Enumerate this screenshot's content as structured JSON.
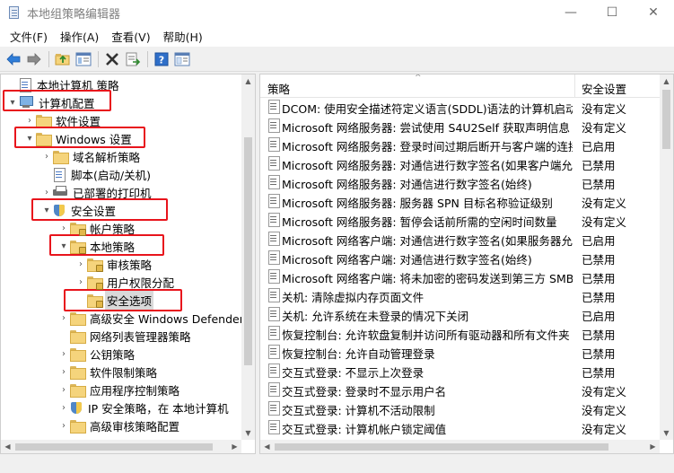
{
  "window": {
    "title": "本地组策略编辑器",
    "controls": {
      "minimize": "—",
      "maximize": "☐",
      "close": "✕"
    }
  },
  "menu": [
    "文件(F)",
    "操作(A)",
    "查看(V)",
    "帮助(H)"
  ],
  "toolbar": {
    "buttons": [
      "back-arrow-icon",
      "forward-arrow-icon",
      "up-folder-icon",
      "show-hide-tree-icon",
      "delete-icon",
      "export-list-icon",
      "help-icon",
      "properties-icon"
    ]
  },
  "tree": {
    "items": [
      {
        "label": "本地计算机 策略",
        "icon": "doc-icon",
        "indent": 0,
        "expander": ""
      },
      {
        "label": "计算机配置",
        "icon": "pc-icon",
        "indent": 0,
        "expander": "▾"
      },
      {
        "label": "软件设置",
        "icon": "folder-icon",
        "indent": 1,
        "expander": "›"
      },
      {
        "label": "Windows 设置",
        "icon": "folder-icon",
        "indent": 1,
        "expander": "▾"
      },
      {
        "label": "域名解析策略",
        "icon": "folder-icon",
        "indent": 2,
        "expander": "›"
      },
      {
        "label": "脚本(启动/关机)",
        "icon": "doc-icon",
        "indent": 2,
        "expander": ""
      },
      {
        "label": "已部署的打印机",
        "icon": "printer-icon",
        "indent": 2,
        "expander": "›"
      },
      {
        "label": "安全设置",
        "icon": "shield-icon",
        "indent": 2,
        "expander": "▾"
      },
      {
        "label": "帐户策略",
        "icon": "lock-folder-icon",
        "indent": 3,
        "expander": "›"
      },
      {
        "label": "本地策略",
        "icon": "lock-folder-icon",
        "indent": 3,
        "expander": "▾"
      },
      {
        "label": "审核策略",
        "icon": "lock-folder-icon",
        "indent": 4,
        "expander": "›"
      },
      {
        "label": "用户权限分配",
        "icon": "lock-folder-icon",
        "indent": 4,
        "expander": "›"
      },
      {
        "label": "安全选项",
        "icon": "lock-folder-icon",
        "indent": 4,
        "expander": "",
        "selected": true
      },
      {
        "label": "高级安全 Windows Defender",
        "icon": "folder-icon",
        "indent": 3,
        "expander": "›"
      },
      {
        "label": "网络列表管理器策略",
        "icon": "folder-icon",
        "indent": 3,
        "expander": ""
      },
      {
        "label": "公钥策略",
        "icon": "folder-icon",
        "indent": 3,
        "expander": "›"
      },
      {
        "label": "软件限制策略",
        "icon": "folder-icon",
        "indent": 3,
        "expander": "›"
      },
      {
        "label": "应用程序控制策略",
        "icon": "folder-icon",
        "indent": 3,
        "expander": "›"
      },
      {
        "label": "IP 安全策略，在 本地计算机",
        "icon": "shield-icon",
        "indent": 3,
        "expander": "›"
      },
      {
        "label": "高级审核策略配置",
        "icon": "folder-icon",
        "indent": 3,
        "expander": "›"
      }
    ]
  },
  "list": {
    "col_policy": "策略",
    "col_setting": "安全设置",
    "sort_indicator": "^",
    "rows": [
      {
        "policy": "DCOM: 使用安全描述符定义语言(SDDL)语法的计算机启动...",
        "setting": "没有定义"
      },
      {
        "policy": "Microsoft 网络服务器: 尝试使用 S4U2Self 获取声明信息",
        "setting": "没有定义"
      },
      {
        "policy": "Microsoft 网络服务器: 登录时间过期后断开与客户端的连接",
        "setting": "已启用"
      },
      {
        "policy": "Microsoft 网络服务器: 对通信进行数字签名(如果客户端允...",
        "setting": "已禁用"
      },
      {
        "policy": "Microsoft 网络服务器: 对通信进行数字签名(始终)",
        "setting": "已禁用"
      },
      {
        "policy": "Microsoft 网络服务器: 服务器 SPN 目标名称验证级别",
        "setting": "没有定义"
      },
      {
        "policy": "Microsoft 网络服务器: 暂停会话前所需的空闲时间数量",
        "setting": "没有定义"
      },
      {
        "policy": "Microsoft 网络客户端: 对通信进行数字签名(如果服务器允...",
        "setting": "已启用"
      },
      {
        "policy": "Microsoft 网络客户端: 对通信进行数字签名(始终)",
        "setting": "已禁用"
      },
      {
        "policy": "Microsoft 网络客户端: 将未加密的密码发送到第三方 SMB...",
        "setting": "已禁用"
      },
      {
        "policy": "关机: 清除虚拟内存页面文件",
        "setting": "已禁用"
      },
      {
        "policy": "关机: 允许系统在未登录的情况下关闭",
        "setting": "已启用"
      },
      {
        "policy": "恢复控制台: 允许软盘复制并访问所有驱动器和所有文件夹",
        "setting": "已禁用"
      },
      {
        "policy": "恢复控制台: 允许自动管理登录",
        "setting": "已禁用"
      },
      {
        "policy": "交互式登录: 不显示上次登录",
        "setting": "已禁用"
      },
      {
        "policy": "交互式登录: 登录时不显示用户名",
        "setting": "没有定义"
      },
      {
        "policy": "交互式登录: 计算机不活动限制",
        "setting": "没有定义"
      },
      {
        "policy": "交互式登录: 计算机帐户锁定阈值",
        "setting": "没有定义"
      }
    ]
  },
  "scrollbars": {
    "left_vertical_position": 0.45,
    "right_vertical_position": 0.0,
    "left_horizontal_position": 0.0,
    "right_horizontal_position": 0.0
  },
  "colors": {
    "highlight_box": "#e8141c",
    "selection": "#d9d9d9"
  }
}
